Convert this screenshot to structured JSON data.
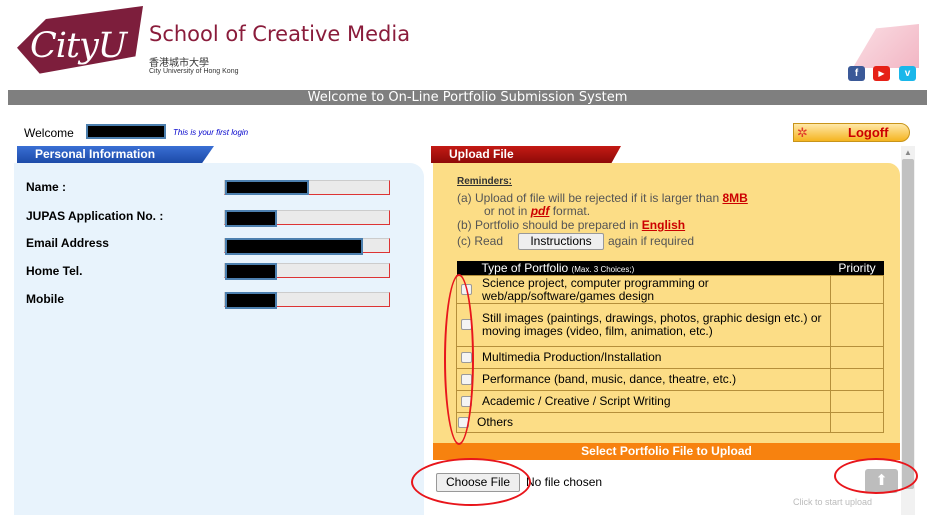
{
  "header": {
    "logo_text": "CityU",
    "school_name": "School of Creative Media",
    "university_chinese": "香港城市大學",
    "university_english": "City University of Hong Kong",
    "social": {
      "facebook": "f",
      "youtube": "▶",
      "vimeo": "v"
    },
    "title_bar": "Welcome to On-Line Portfolio Submission System"
  },
  "welcome": {
    "label": "Welcome",
    "first_login_note": "This is your first login",
    "logoff_label": "Logoff"
  },
  "personal": {
    "tab_title": "Personal Information",
    "fields": [
      {
        "label": "Name :"
      },
      {
        "label": "JUPAS Application No. :"
      },
      {
        "label": "Email Address"
      },
      {
        "label": "Home Tel."
      },
      {
        "label": "Mobile"
      }
    ]
  },
  "upload": {
    "tab_title": "Upload File",
    "reminders_title": "Reminders:",
    "reminder_a_pre": "(a) Upload of file will be rejected if it is larger than ",
    "reminder_a_size": "8MB",
    "reminder_a2_pre": "or not in ",
    "reminder_a2_fmt": "pdf",
    "reminder_a2_post": " format.",
    "reminder_b_pre": "(b) Portfolio should be prepared in ",
    "reminder_b_lang": "English",
    "reminder_c_pre": "(c) Read",
    "instructions_button": "Instructions",
    "reminder_c_post": "again if required",
    "table_header_type": "Type of Portfolio ",
    "table_header_note": "(Max. 3 Choices;)",
    "table_header_priority": "Priority",
    "portfolio_types": [
      "Science project, computer programming or web/app/software/games design",
      "Still images (paintings, drawings, photos, graphic design etc.) or moving images (video, film, animation, etc.)",
      "Multimedia Production/Installation",
      "Performance (band, music, dance, theatre, etc.)",
      "Academic / Creative / Script Writing",
      "Others"
    ],
    "select_bar": "Select Portfolio File to Upload",
    "choose_file_button": "Choose File",
    "no_file_text": "No file chosen",
    "upload_caption": "Click to start upload"
  },
  "colors": {
    "brand": "#7d1e3c",
    "personal_tab": "#2455b8",
    "upload_tab": "#a50e0b",
    "upload_panel": "#fcdd86",
    "select_bar": "#f7820f",
    "annotation": "#e8151b"
  }
}
